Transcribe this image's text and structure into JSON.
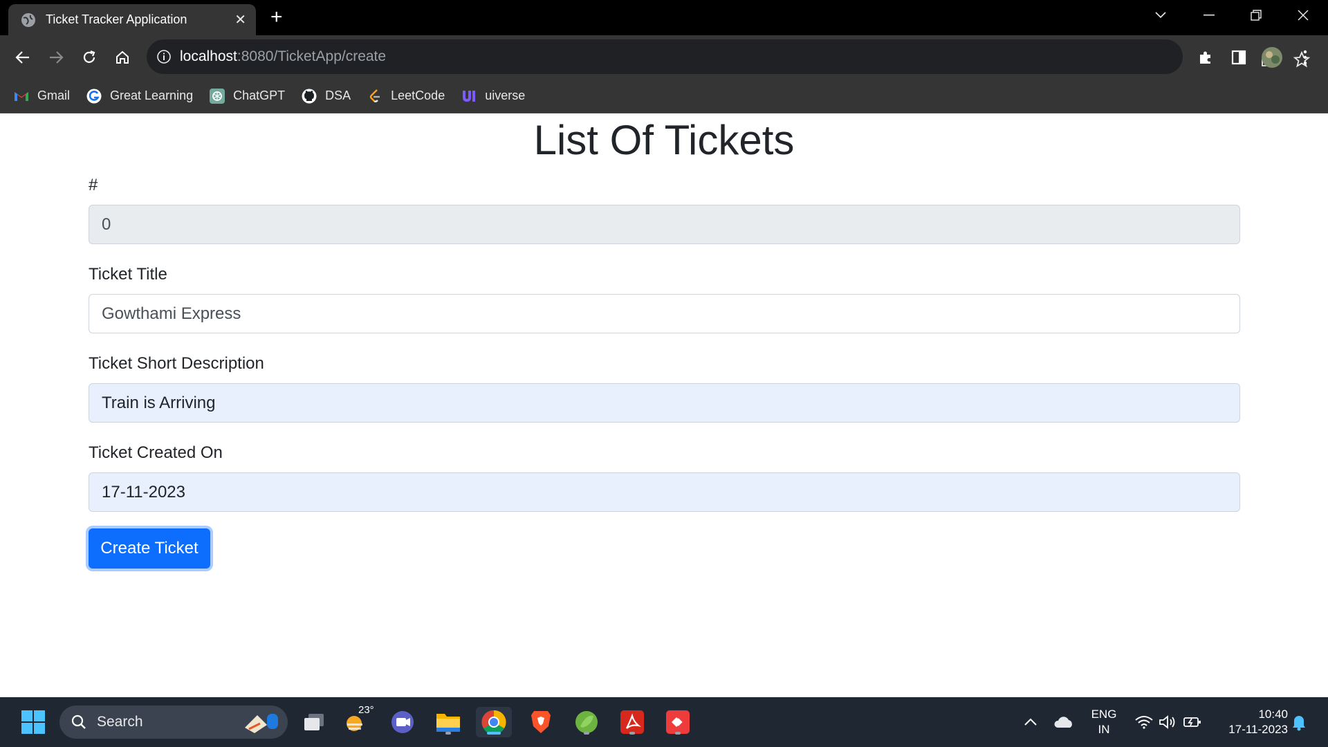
{
  "browser": {
    "tab_title": "Ticket Tracker Application",
    "url_host": "localhost",
    "url_path": ":8080/TicketApp/create",
    "bookmarks": [
      {
        "label": "Gmail",
        "icon": "gmail-icon"
      },
      {
        "label": "Great Learning",
        "icon": "great-learning-icon"
      },
      {
        "label": "ChatGPT",
        "icon": "chatgpt-icon"
      },
      {
        "label": "DSA",
        "icon": "github-icon"
      },
      {
        "label": "LeetCode",
        "icon": "leetcode-icon"
      },
      {
        "label": "uiverse",
        "icon": "uiverse-icon"
      }
    ]
  },
  "page": {
    "title": "List Of Tickets",
    "fields": [
      {
        "label": "#",
        "value": "0"
      },
      {
        "label": "Ticket Title",
        "value": "Gowthami Express"
      },
      {
        "label": "Ticket Short Description",
        "value": "Train is Arriving"
      },
      {
        "label": "Ticket Created On",
        "value": "17-11-2023"
      }
    ],
    "submit_label": "Create Ticket",
    "accent": "#0d6efd"
  },
  "taskbar": {
    "search_label": "Search",
    "weather_temp": "23°",
    "language": "ENG",
    "region": "IN",
    "time": "10:40",
    "date": "17-11-2023"
  }
}
